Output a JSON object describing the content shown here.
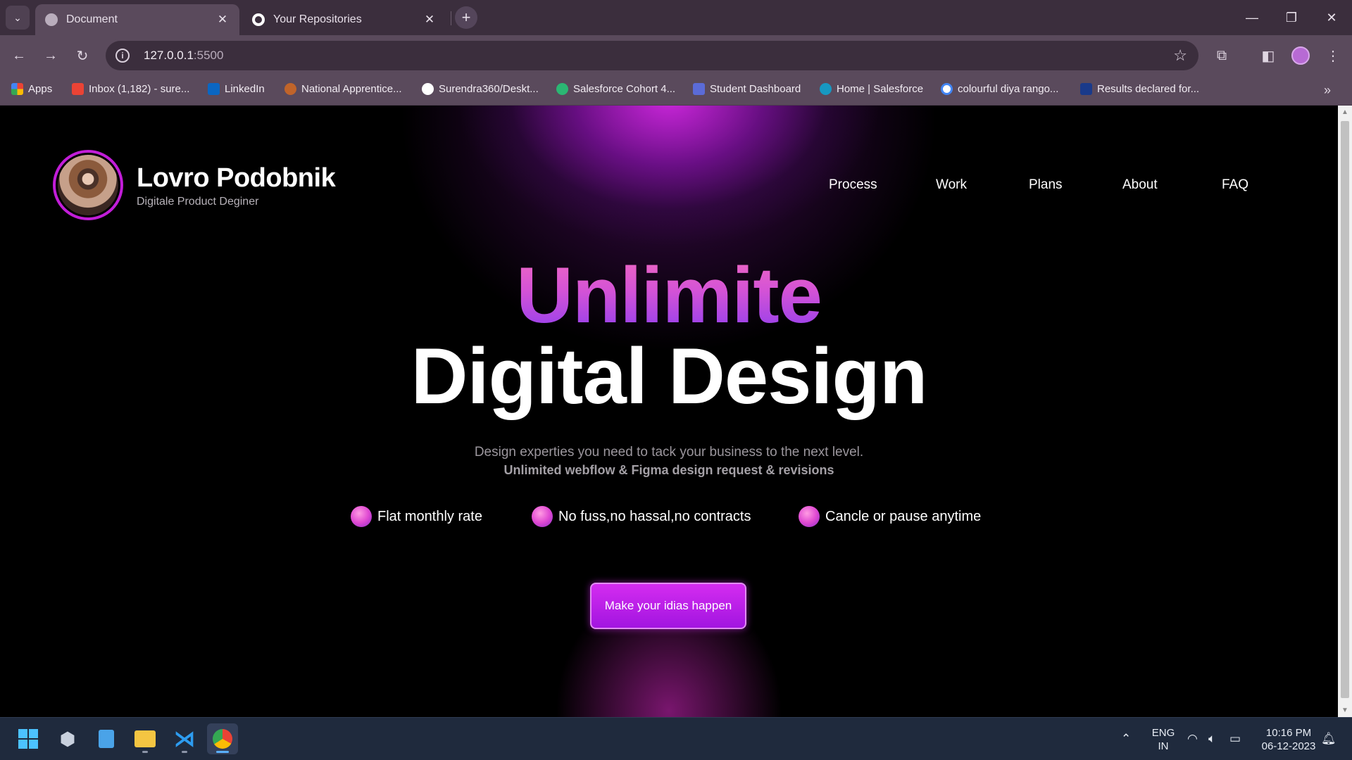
{
  "browser": {
    "tabs": [
      {
        "title": "Document",
        "active": true
      },
      {
        "title": "Your Repositories",
        "active": false
      }
    ],
    "url_host": "127.0.0.1",
    "url_port": ":5500",
    "bookmarks": [
      {
        "label": "Apps",
        "color": "#e94235"
      },
      {
        "label": "Inbox (1,182) - sure...",
        "color": "#ea4335"
      },
      {
        "label": "LinkedIn",
        "color": "#0a66c2"
      },
      {
        "label": "National Apprentice...",
        "color": "#c0642a"
      },
      {
        "label": "Surendra360/Deskt...",
        "color": "#ffffff"
      },
      {
        "label": "Salesforce Cohort 4...",
        "color": "#2bb673"
      },
      {
        "label": "Student Dashboard",
        "color": "#5b6bd8"
      },
      {
        "label": "Home | Salesforce",
        "color": "#1798c1"
      },
      {
        "label": "colourful diya rango...",
        "color": "#ffffff"
      },
      {
        "label": "Results declared for...",
        "color": "#1a3a8a"
      }
    ]
  },
  "site": {
    "brand_name": "Lovro Podobnik",
    "brand_subtitle": "Digitale Product Deginer",
    "nav": [
      "Process",
      "Work",
      "Plans",
      "About",
      "FAQ"
    ],
    "hero_line1": "Unlimite",
    "hero_line2": "Digital Design",
    "subtitle_line1": "Design experties you need to tack your business to the next level.",
    "subtitle_line2": "Unlimited webflow & Figma design request & revisions",
    "features": [
      "Flat monthly rate",
      "No fuss,no hassal,no contracts",
      "Cancle or pause anytime"
    ],
    "cta_label": "Make your idias happen",
    "accent_color": "#c21dd8"
  },
  "taskbar": {
    "language_line1": "ENG",
    "language_line2": "IN",
    "time": "10:16 PM",
    "date": "06-12-2023"
  }
}
